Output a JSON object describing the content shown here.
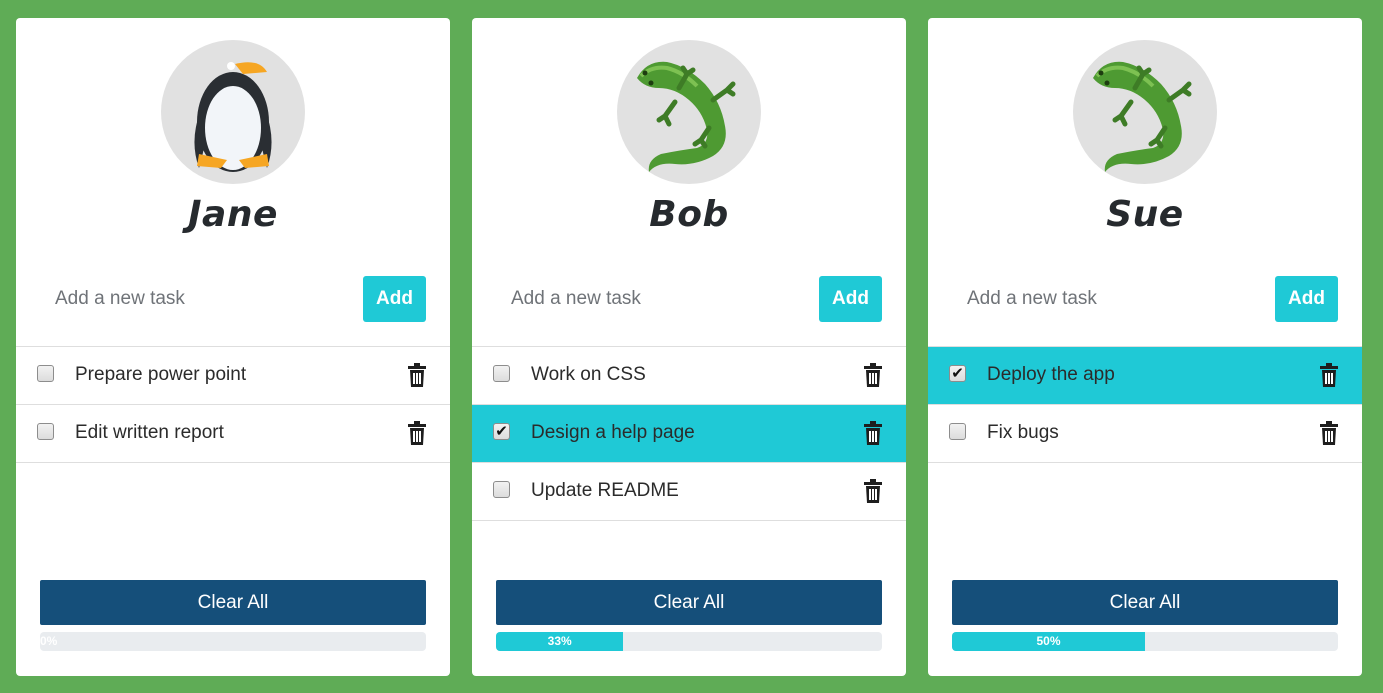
{
  "accent_color": "#1fc9d6",
  "clear_button_color": "#154f7a",
  "background_color": "#5fac56",
  "cards": [
    {
      "name": "Jane",
      "avatar_icon": "penguin-icon",
      "input_placeholder": "Add a new task",
      "input_value": "",
      "add_label": "Add",
      "clear_label": "Clear All",
      "progress": 0,
      "progress_label": "0%",
      "tasks": [
        {
          "label": "Prepare power point",
          "done": false
        },
        {
          "label": "Edit written report",
          "done": false
        }
      ]
    },
    {
      "name": "Bob",
      "avatar_icon": "lizard-icon",
      "input_placeholder": "Add a new task",
      "input_value": "",
      "add_label": "Add",
      "clear_label": "Clear All",
      "progress": 33,
      "progress_label": "33%",
      "tasks": [
        {
          "label": "Work on CSS",
          "done": false
        },
        {
          "label": "Design a help page",
          "done": true
        },
        {
          "label": "Update README",
          "done": false
        }
      ]
    },
    {
      "name": "Sue",
      "avatar_icon": "lizard-icon",
      "input_placeholder": "Add a new task",
      "input_value": "",
      "add_label": "Add",
      "clear_label": "Clear All",
      "progress": 50,
      "progress_label": "50%",
      "tasks": [
        {
          "label": "Deploy the app",
          "done": true
        },
        {
          "label": "Fix bugs",
          "done": false
        }
      ]
    }
  ]
}
